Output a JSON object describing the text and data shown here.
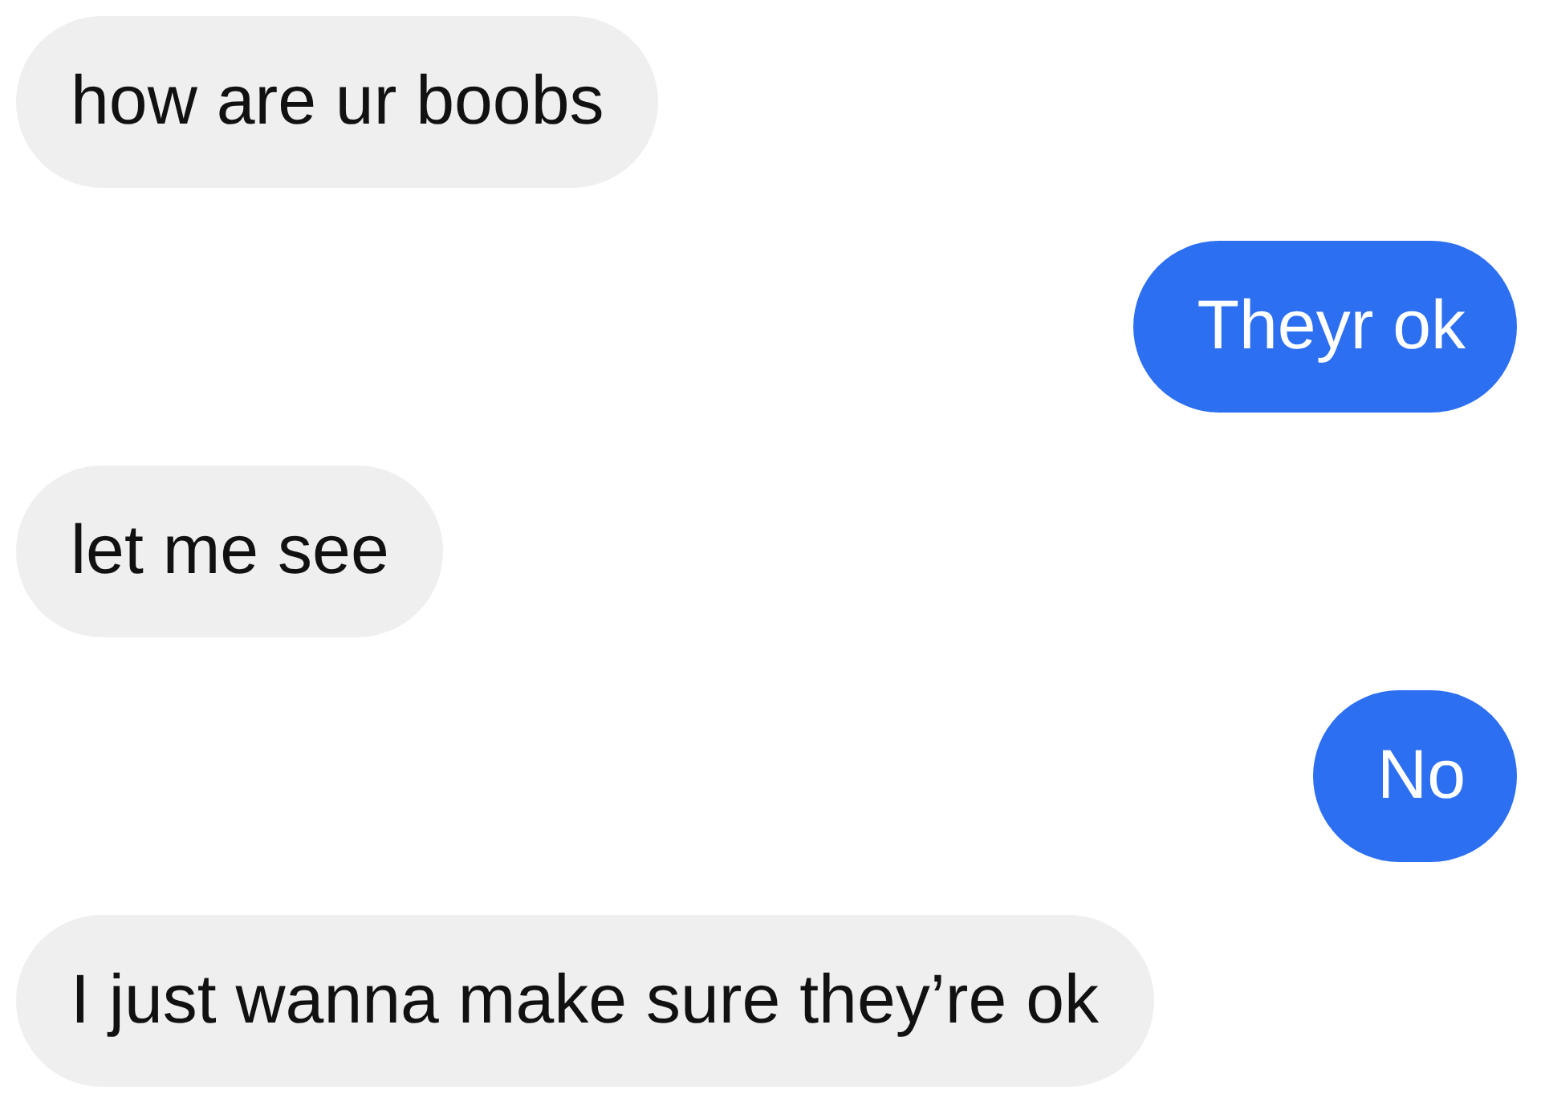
{
  "messages": [
    {
      "kind": "received",
      "text": "how are ur boobs"
    },
    {
      "kind": "sent",
      "text": "Theyr ok"
    },
    {
      "kind": "received",
      "text": "let me see"
    },
    {
      "kind": "sent",
      "text": "No"
    },
    {
      "kind": "received",
      "text": "I just wanna make sure they’re ok"
    }
  ]
}
